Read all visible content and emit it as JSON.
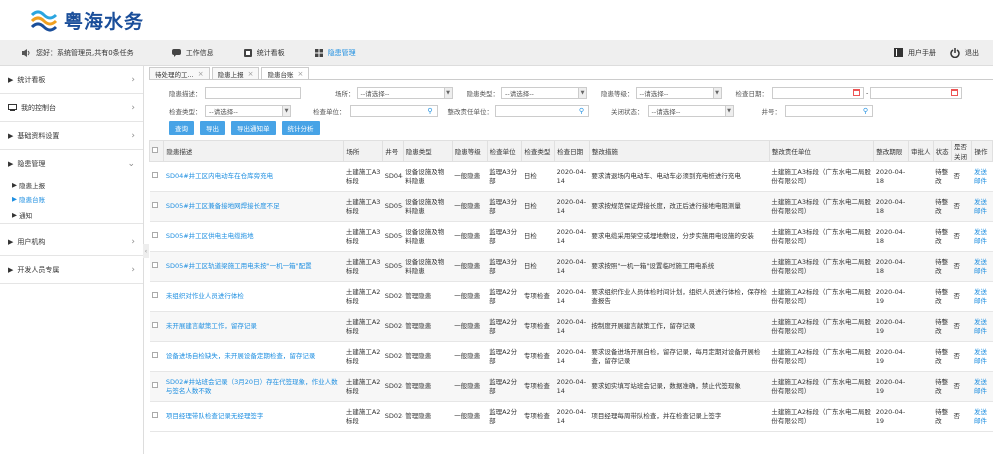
{
  "header": {
    "logo_text": "粤海水务"
  },
  "toolbar": {
    "greeting": "您好：系统管理员,共有0条任务",
    "work_info": "工作信息",
    "stats_board": "统计看板",
    "hazard_mgmt": "隐患管理",
    "user_manual": "用户手册",
    "logout": "退出"
  },
  "sidebar": {
    "sections": [
      {
        "label": "统计看板"
      },
      {
        "label": "我的控制台"
      },
      {
        "label": "基础资料设置"
      },
      {
        "label": "隐患管理"
      }
    ],
    "subitems": [
      {
        "label": "隐患上报"
      },
      {
        "label": "隐患台账"
      },
      {
        "label": "通知"
      }
    ],
    "sections2": [
      {
        "label": "用户机构"
      },
      {
        "label": "开发人员专属"
      }
    ]
  },
  "tabs": [
    {
      "label": "待处理的工..."
    },
    {
      "label": "隐患上报"
    },
    {
      "label": "隐患台账"
    }
  ],
  "filters": {
    "desc_label": "隐患描述：",
    "site_label": "场所：",
    "type_label": "隐患类型：",
    "level_label": "隐患等级：",
    "date_label": "检查日期：",
    "check_type_label": "检查类型：",
    "check_unit_label": "检查单位：",
    "resp_unit_label": "整改责任单位：",
    "close_status_label": "关闭状态：",
    "well_label": "井号：",
    "select_placeholder": "--请选择--",
    "date_sep": "-"
  },
  "buttons": {
    "query": "查询",
    "export": "导出",
    "export_notice": "导出通知单",
    "stats": "统计分析"
  },
  "table": {
    "headers": [
      "",
      "隐患描述",
      "场所",
      "井号",
      "隐患类型",
      "隐患等级",
      "检查单位",
      "检查类型",
      "检查日期",
      "整改措施",
      "整改责任单位",
      "整改期限",
      "审批人",
      "状态",
      "是否关闭",
      "操作"
    ],
    "rows": [
      [
        "SD04#井工区内电动车在仓库旁充电",
        "土建施工A3标段",
        "SD04#",
        "设备设施及物料隐患",
        "一般隐患",
        "监理A3分部",
        "日检",
        "2020-04-14",
        "要求清退场内电动车、电动车必须到充电桩进行充电",
        "土建施工A3标段（广东水电二局股份有限公司）",
        "2020-04-18",
        "",
        "待整改",
        "否",
        "发送邮件"
      ],
      [
        "SD05#井工区兼备接地网焊接长度不足",
        "土建施工A3标段",
        "SD05#",
        "设备设施及物料隐患",
        "一般隐患",
        "监理A3分部",
        "日检",
        "2020-04-14",
        "要求按规范保证焊接长度，改正后进行接地电阻测量",
        "土建施工A3标段（广东水电二局股份有限公司）",
        "2020-04-18",
        "",
        "待整改",
        "否",
        "发送邮件"
      ],
      [
        "SD05#井工区供电主电缆拖地",
        "土建施工A3标段",
        "SD05#",
        "设备设施及物料隐患",
        "一般隐患",
        "监理A3分部",
        "日检",
        "2020-04-14",
        "要求电缆采用架空或埋地敷设，分步实施用电设施的安装",
        "土建施工A3标段（广东水电二局股份有限公司）",
        "2020-04-18",
        "",
        "待整改",
        "否",
        "发送邮件"
      ],
      [
        "SD05#井工区轨道梁施工用电未按\"一机一箱\"配置",
        "土建施工A3标段",
        "SD05#",
        "设备设施及物料隐患",
        "一般隐患",
        "监理A3分部",
        "日检",
        "2020-04-14",
        "要求按照\"一机一箱\"设置临时施工用电系统",
        "土建施工A3标段（广东水电二局股份有限公司）",
        "2020-04-18",
        "",
        "待整改",
        "否",
        "发送邮件"
      ],
      [
        "未组织对作业人员进行体检",
        "土建施工A2标段",
        "SD02#",
        "管理隐患",
        "一般隐患",
        "监理A2分部",
        "专项检查",
        "2020-04-14",
        "要求组织作业人员体检时间计划，组织人员进行体检，保存检查报告",
        "土建施工A2标段（广东水电二局股份有限公司）",
        "2020-04-19",
        "",
        "待整改",
        "否",
        "发送邮件"
      ],
      [
        "未开展建言献策工作，留存记录",
        "土建施工A2标段",
        "SD02#",
        "管理隐患",
        "一般隐患",
        "监理A2分部",
        "专项检查",
        "2020-04-14",
        "按制度开展建言献策工作，留存记录",
        "土建施工A2标段（广东水电二局股份有限公司）",
        "2020-04-19",
        "",
        "待整改",
        "否",
        "发送邮件"
      ],
      [
        "设备进场自检缺失，未开展设备定期检查，留存记录",
        "土建施工A2标段",
        "SD02#",
        "管理隐患",
        "一般隐患",
        "监理A2分部",
        "专项检查",
        "2020-04-14",
        "要求设备进场开展自检，留存记录，每月定期对设备开展检查，留存记录",
        "土建施工A2标段（广东水电二局股份有限公司）",
        "2020-04-19",
        "",
        "待整改",
        "否",
        "发送邮件"
      ],
      [
        "SD02#井站班会记录（3月20日）存在代签现象，作业人数与签名人数不致",
        "土建施工A2标段",
        "SD02#",
        "管理隐患",
        "一般隐患",
        "监理A2分部",
        "专项检查",
        "2020-04-14",
        "要求如实填写站班会记录，数据准确，禁止代签现象",
        "土建施工A2标段（广东水电二局股份有限公司）",
        "2020-04-19",
        "",
        "待整改",
        "否",
        "发送邮件"
      ],
      [
        "项目经理带队检查记录无经理签字",
        "土建施工A2标段",
        "SD02#",
        "管理隐患",
        "一般隐患",
        "监理A2分部",
        "专项检查",
        "2020-04-14",
        "项目经理每周带队检查，并在检查记录上签字",
        "土建施工A2标段（广东水电二局股份有限公司）",
        "2020-04-19",
        "",
        "待整改",
        "否",
        "发送邮件"
      ]
    ]
  }
}
